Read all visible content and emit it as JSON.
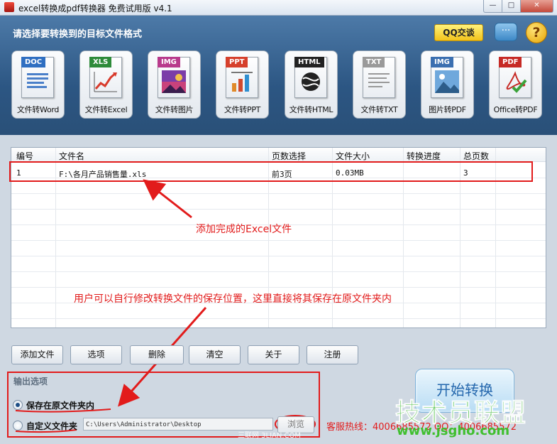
{
  "window": {
    "title": "excel转换成pdf转换器 免费试用版 v4.1",
    "min_glyph": "—",
    "max_glyph": "□",
    "close_glyph": "✕"
  },
  "header": {
    "title": "请选择要转换到的目标文件格式",
    "qq_label": "QQ交谈",
    "chat_glyph": "···",
    "help_glyph": "?"
  },
  "formats": [
    {
      "badge": "DOC",
      "label": "文件转Word",
      "badge_color": "#2f6fc1",
      "icon": "word-document-icon"
    },
    {
      "badge": "XLS",
      "label": "文件转Excel",
      "badge_color": "#2e8b3a",
      "icon": "excel-chart-icon"
    },
    {
      "badge": "IMG",
      "label": "文件转图片",
      "badge_color": "#b83a8c",
      "icon": "image-file-icon"
    },
    {
      "badge": "PPT",
      "label": "文件转PPT",
      "badge_color": "#d6402c",
      "icon": "ppt-chart-icon"
    },
    {
      "badge": "HTML",
      "label": "文件转HTML",
      "badge_color": "#222222",
      "icon": "globe-icon"
    },
    {
      "badge": "TXT",
      "label": "文件转TXT",
      "badge_color": "#9a9a9a",
      "icon": "text-file-icon"
    },
    {
      "badge": "IMG",
      "label": "图片转PDF",
      "badge_color": "#3b6fb0",
      "icon": "picture-icon"
    },
    {
      "badge": "PDF",
      "label": "Office转PDF",
      "badge_color": "#c62a25",
      "icon": "pdf-acrobat-icon"
    }
  ],
  "table": {
    "columns": [
      "编号",
      "文件名",
      "页数选择",
      "文件大小",
      "转换进度",
      "总页数"
    ],
    "rows": [
      {
        "id": "1",
        "filename": "F:\\各月产品销售量.xls",
        "pages": "前3页",
        "size": "0.03MB",
        "progress": "",
        "total": "3"
      }
    ]
  },
  "annotations": {
    "added": "添加完成的Excel文件",
    "save_note": "用户可以自行修改转换文件的保存位置，这里直接将其保存在原文件夹内"
  },
  "toolbar": {
    "add": "添加文件",
    "options": "选项",
    "delete": "删除",
    "clear": "清空",
    "about": "关于",
    "register": "注册"
  },
  "output": {
    "group_title": "输出选项",
    "opt_original": "保存在原文件夹内",
    "opt_custom": "自定义文件夹",
    "path": "C:\\Users\\Administrator\\Desktop",
    "browse": "浏览",
    "selected": "original"
  },
  "hotline": "客服热线：4006685572 QQ：4006685572",
  "start_button": "开始转换",
  "watermark": {
    "brand": "技术员联盟",
    "url": "www.jsgho.com",
    "small": "三联网 3LIAN.COM"
  },
  "colors": {
    "annotation_red": "#e21b1b",
    "header_blue": "#2c5683",
    "watermark_green": "#3fbf2e"
  }
}
